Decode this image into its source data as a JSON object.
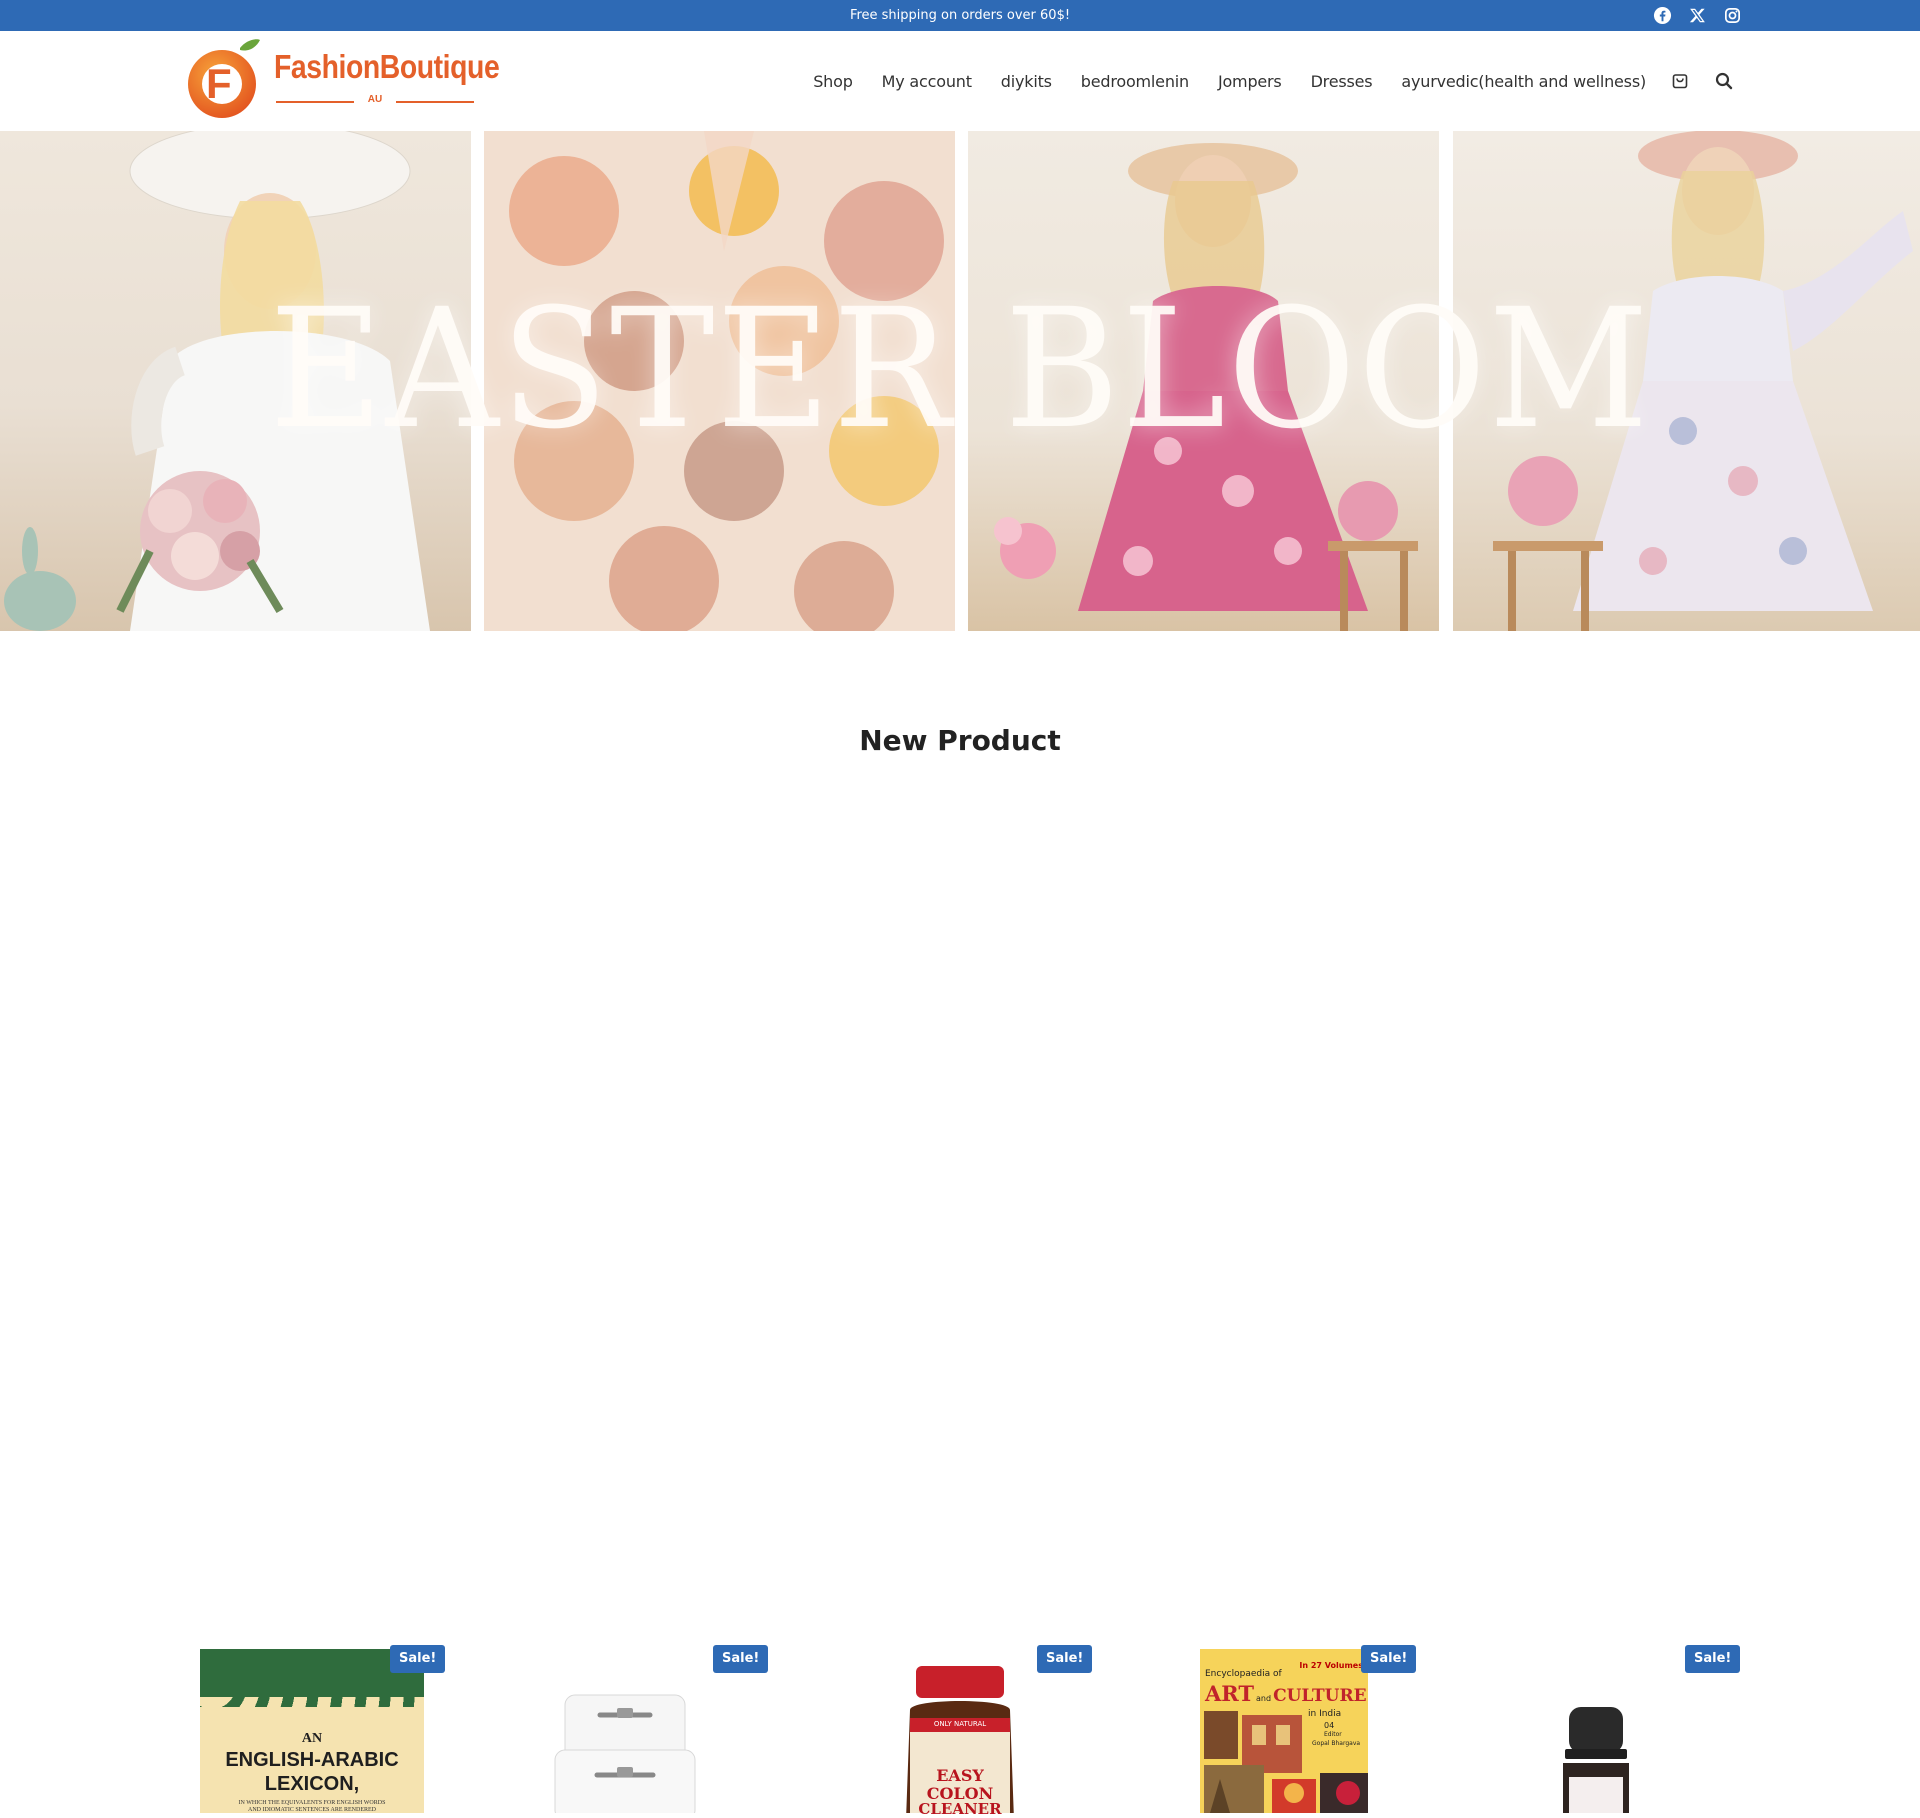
{
  "topbar": {
    "message": "Free shipping on orders over 60$!",
    "social": [
      {
        "icon": "facebook-icon"
      },
      {
        "icon": "x-twitter-icon"
      },
      {
        "icon": "instagram-icon"
      }
    ]
  },
  "brand": {
    "logo_letter": "F",
    "name": "FashionBoutique",
    "suffix": "AU",
    "color": "#e4602a"
  },
  "nav": {
    "items": [
      "Shop",
      "My account",
      "diykits",
      "bedroomlenin",
      "Jompers",
      "Dresses",
      "ayurvedic(health and wellness)"
    ],
    "cart_icon": "cart-icon",
    "search_icon": "search-icon"
  },
  "hero": {
    "title": "EASTER BLOOM"
  },
  "section": {
    "title": "New Product"
  },
  "products": [
    {
      "badge": "Sale!",
      "cover_lines": [
        "AN",
        "ENGLISH-ARABIC",
        "LEXICON,",
        "IN WHICH THE EQUIVALENTS FOR ENGLISH WORDS",
        "AND IDIOMATIC SENTENCES ARE RENDERED"
      ]
    },
    {
      "badge": "Sale!"
    },
    {
      "badge": "Sale!",
      "label_lines": [
        "EASY",
        "COLON",
        "CLEANER"
      ],
      "small_label": "ONLY NATURAL"
    },
    {
      "badge": "Sale!",
      "cover_lines": [
        "Encyclopaedia of",
        "ART",
        "and",
        "CULTURE",
        "in India",
        "In 27 Volumes",
        "04",
        "Editor",
        "Gopal Bhargava"
      ]
    },
    {
      "badge": "Sale!"
    }
  ],
  "colors": {
    "accent": "#2e6ab5",
    "brand_orange": "#e4602a"
  }
}
